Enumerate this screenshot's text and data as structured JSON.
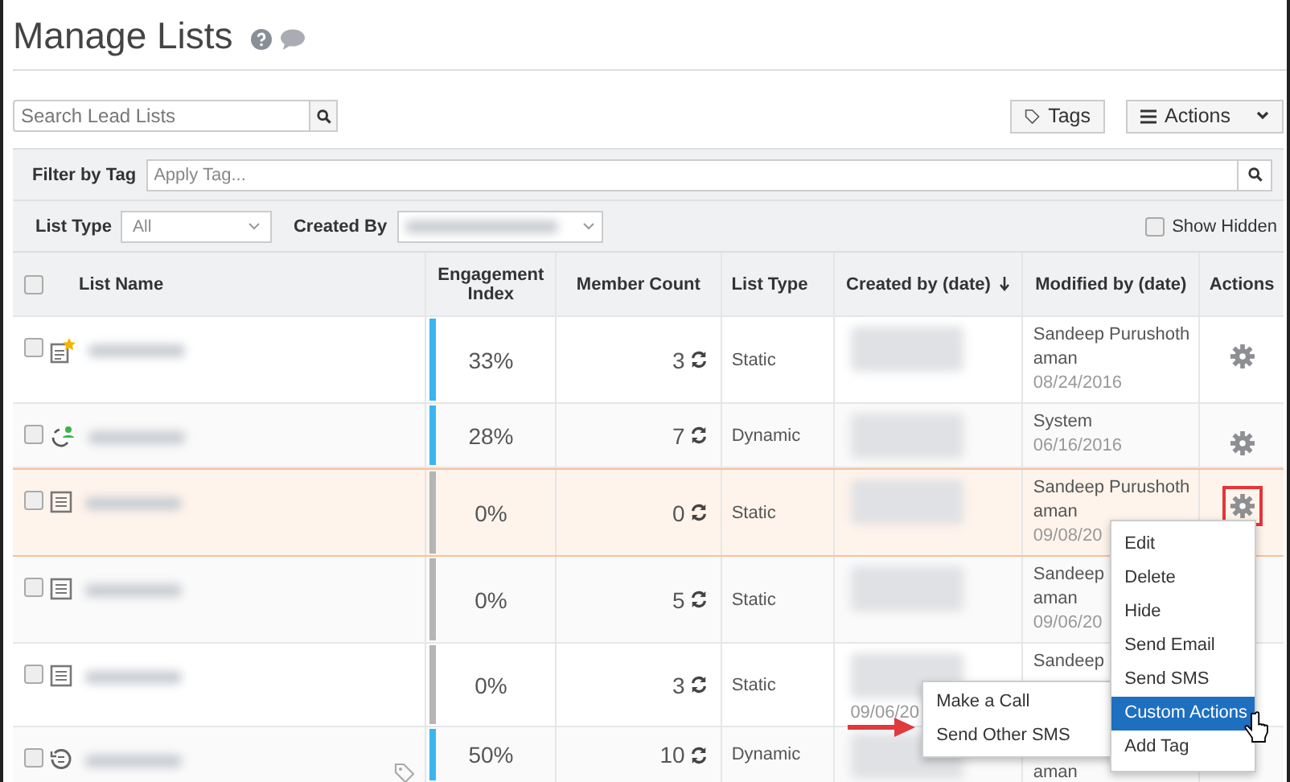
{
  "title": "Manage Lists",
  "search": {
    "placeholder": "Search Lead Lists"
  },
  "toolbar": {
    "tags_button": "Tags",
    "actions_button": "Actions"
  },
  "filter": {
    "label": "Filter by Tag",
    "placeholder": "Apply Tag..."
  },
  "filters": {
    "list_type_label": "List Type",
    "list_type_value": "All",
    "created_by_label": "Created By",
    "show_hidden": {
      "label": "Show Hidden",
      "checked": false
    }
  },
  "table": {
    "select_all": {
      "checked": false
    },
    "columns": [
      "List Name",
      "Engagement Index",
      "Member Count",
      "List Type",
      "Created by (date)",
      "Modified by (date)",
      "Actions"
    ],
    "rows": [
      {
        "kind": "starred",
        "checked": false,
        "tagged": false,
        "engagement": "33%",
        "engaged": true,
        "count": "3",
        "type": "Static",
        "modified": [
          "Sandeep Purushoth",
          "aman"
        ],
        "modified_date": "08/24/2016",
        "selected": false,
        "menu_open": false,
        "gear": true
      },
      {
        "kind": "dynamic",
        "checked": false,
        "tagged": false,
        "engagement": "28%",
        "engaged": true,
        "count": "7",
        "type": "Dynamic",
        "modified": [
          "System"
        ],
        "modified_date": "06/16/2016",
        "selected": false,
        "menu_open": false,
        "gear": true
      },
      {
        "kind": "static",
        "checked": false,
        "tagged": false,
        "engagement": "0%",
        "engaged": false,
        "count": "0",
        "type": "Static",
        "modified": [
          "Sandeep Purushoth",
          "aman"
        ],
        "modified_date": "09/08/20",
        "selected": true,
        "menu_open": true,
        "gear": true
      },
      {
        "kind": "static",
        "checked": false,
        "tagged": false,
        "engagement": "0%",
        "engaged": false,
        "count": "5",
        "type": "Static",
        "modified": [
          "Sandeep",
          "aman"
        ],
        "modified_date": "09/06/20",
        "selected": false,
        "menu_open": false
      },
      {
        "kind": "static",
        "checked": false,
        "tagged": false,
        "engagement": "0%",
        "engaged": false,
        "count": "3",
        "type": "Static",
        "created_date": "09/06/20",
        "modified": [
          "Sandeep"
        ],
        "selected": false,
        "menu_open": false
      },
      {
        "kind": "history",
        "checked": false,
        "tagged": true,
        "engagement": "50%",
        "engaged": true,
        "count": "10",
        "type": "Dynamic",
        "modified": [
          "aman"
        ],
        "selected": false,
        "menu_open": false
      }
    ]
  },
  "menu": {
    "items": [
      {
        "label": "Edit",
        "selected": false
      },
      {
        "label": "Delete",
        "selected": false
      },
      {
        "label": "Hide",
        "selected": false
      },
      {
        "label": "Send Email",
        "selected": false
      },
      {
        "label": "Send SMS",
        "selected": false
      },
      {
        "label": "Custom Actions",
        "selected": true
      },
      {
        "label": "Add Tag",
        "selected": false
      }
    ],
    "submenu": [
      {
        "label": "Make a Call",
        "selected": false
      },
      {
        "label": "Send Other SMS",
        "selected": false
      }
    ]
  }
}
